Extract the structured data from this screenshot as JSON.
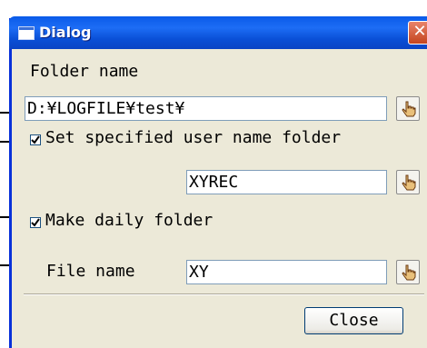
{
  "window": {
    "title": "Dialog",
    "close_glyph": "✕"
  },
  "folder": {
    "label": "Folder name",
    "value": "D:¥LOGFILE¥test¥",
    "browse_icon": "pointing-hand-icon"
  },
  "user_folder": {
    "checkbox_label": "Set specified user name folder",
    "checked": true,
    "value": "XYREC",
    "browse_icon": "pointing-hand-icon"
  },
  "daily_folder": {
    "checkbox_label": "Make daily folder",
    "checked": true
  },
  "file_name": {
    "label": "File name",
    "value": "XY",
    "browse_icon": "pointing-hand-icon"
  },
  "buttons": {
    "close_label": "Close"
  },
  "colors": {
    "title_bar": "#0a5ae8",
    "dialog_bg": "#ece9d8",
    "close_button": "#c4441e"
  }
}
